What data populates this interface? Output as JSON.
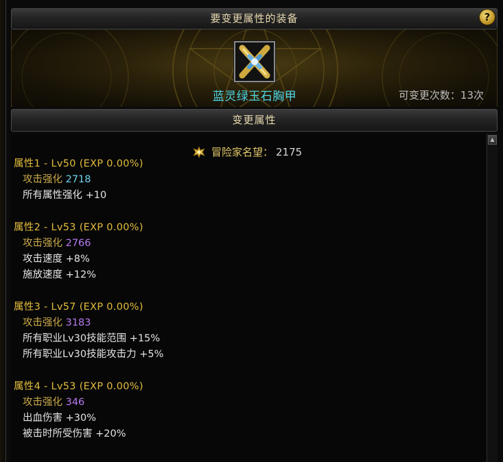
{
  "title": "要变更属性的装备",
  "help_label": "?",
  "equipment": {
    "name": "蓝灵绿玉石胸甲",
    "change_count_label": "可变更次数：",
    "change_count_value": "13次",
    "icon": "chest-armor-icon"
  },
  "section_title": "变更属性",
  "fame": {
    "label": "冒险家名望：",
    "value": "2175",
    "icon": "fame-crest-icon"
  },
  "attributes": [
    {
      "header": "属性1 - Lv50 (EXP 0.00%)",
      "main": {
        "label": "攻击强化",
        "value": "2718",
        "color": "#6fd3ee"
      },
      "options": [
        {
          "label": "所有属性强化",
          "value": "+10"
        }
      ]
    },
    {
      "header": "属性2 - Lv53 (EXP 0.00%)",
      "main": {
        "label": "攻击强化",
        "value": "2766",
        "color": "#b77af0"
      },
      "options": [
        {
          "label": "攻击速度",
          "value": "+8%"
        },
        {
          "label": "施放速度",
          "value": "+12%"
        }
      ]
    },
    {
      "header": "属性3 - Lv57 (EXP 0.00%)",
      "main": {
        "label": "攻击强化",
        "value": "3183",
        "color": "#b77af0"
      },
      "options": [
        {
          "label": "所有职业Lv30技能范围",
          "value": "+15%"
        },
        {
          "label": "所有职业Lv30技能攻击力",
          "value": "+5%"
        }
      ]
    },
    {
      "header": "属性4 - Lv53 (EXP 0.00%)",
      "main": {
        "label": "攻击强化",
        "value": "346",
        "color": "#b77af0"
      },
      "options": [
        {
          "label": "出血伤害",
          "value": "+30%"
        },
        {
          "label": "被击时所受伤害",
          "value": "+20%"
        }
      ]
    }
  ],
  "colors": {
    "header_gold": "#e3bd3d",
    "label_gold": "#c9a94a",
    "item_name": "#4fd6e4"
  }
}
